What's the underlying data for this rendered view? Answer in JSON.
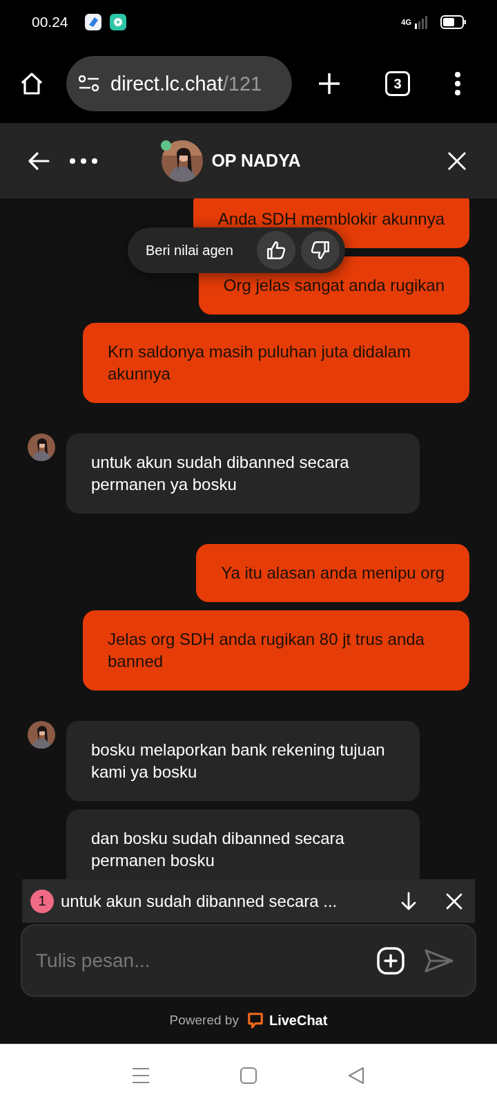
{
  "status_bar": {
    "time": "00.24",
    "network": "4G"
  },
  "browser": {
    "url_host": "direct.lc.chat",
    "url_path": "/121",
    "tab_count": "3"
  },
  "chat_header": {
    "agent_name": "OP NADYA",
    "online": true
  },
  "rating_prompt": {
    "label": "Beri nilai agen"
  },
  "message_groups": [
    {
      "kind": "visitor",
      "messages": [
        "Anda SDH memblokir akunnya",
        "Org jelas sangat anda rugikan",
        "Krn saldonya masih puluhan juta didalam akunnya"
      ]
    },
    {
      "kind": "agent",
      "messages": [
        "untuk akun sudah dibanned secara permanen ya bosku"
      ]
    },
    {
      "kind": "visitor",
      "messages": [
        "Ya itu alasan anda menipu org",
        "Jelas org SDH anda rugikan 80 jt trus anda banned"
      ]
    },
    {
      "kind": "agent",
      "messages": [
        "bosku melaporkan bank rekening tujuan kami ya bosku",
        "dan bosku sudah dibanned secara permanen bosku"
      ]
    }
  ],
  "new_message_bar": {
    "count": "1",
    "preview": "untuk akun sudah dibanned secara ..."
  },
  "composer": {
    "placeholder": "Tulis pesan..."
  },
  "footer": {
    "powered_by": "Powered by",
    "brand": "LiveChat"
  }
}
